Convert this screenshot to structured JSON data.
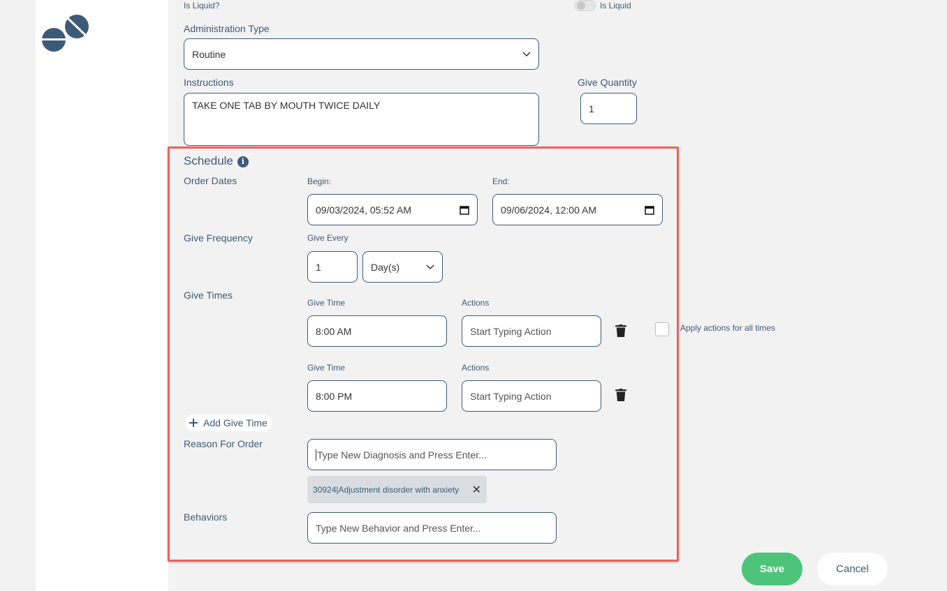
{
  "top": {
    "is_liquid_label": "Is Liquid?",
    "is_liquid_toggle_label": "Is Liquid"
  },
  "administration": {
    "label": "Administration Type",
    "value": "Routine"
  },
  "instructions": {
    "label": "Instructions",
    "value": "TAKE ONE TAB BY MOUTH TWICE DAILY"
  },
  "give_quantity": {
    "label": "Give Quantity",
    "value": "1"
  },
  "schedule": {
    "title": "Schedule",
    "order_dates": {
      "label": "Order Dates",
      "begin_label": "Begin:",
      "begin_value": "09/03/2024, 05:52 AM",
      "end_label": "End:",
      "end_value": "09/06/2024, 12:00 AM"
    },
    "frequency": {
      "label": "Give Frequency",
      "every_label": "Give Every",
      "every_value": "1",
      "unit_value": "Day(s)"
    },
    "give_times": {
      "label": "Give Times",
      "time_label": "Give Time",
      "actions_label": "Actions",
      "apply_all_label": "Apply actions for all times",
      "rows": [
        {
          "time": "8:00 AM",
          "actions_placeholder": "Start Typing Action"
        },
        {
          "time": "8:00 PM",
          "actions_placeholder": "Start Typing Action"
        }
      ],
      "add_label": "Add Give Time"
    },
    "reason": {
      "label": "Reason For Order",
      "placeholder": "Type New Diagnosis and Press Enter...",
      "chip": "30924|Adjustment disorder with anxiety"
    },
    "behaviors": {
      "label": "Behaviors",
      "placeholder": "Type New Behavior and Press Enter..."
    }
  },
  "buttons": {
    "save": "Save",
    "cancel": "Cancel"
  },
  "colors": {
    "accent": "#3d5a78",
    "save_green": "#4dc47a",
    "highlight_red": "#e8645a"
  }
}
